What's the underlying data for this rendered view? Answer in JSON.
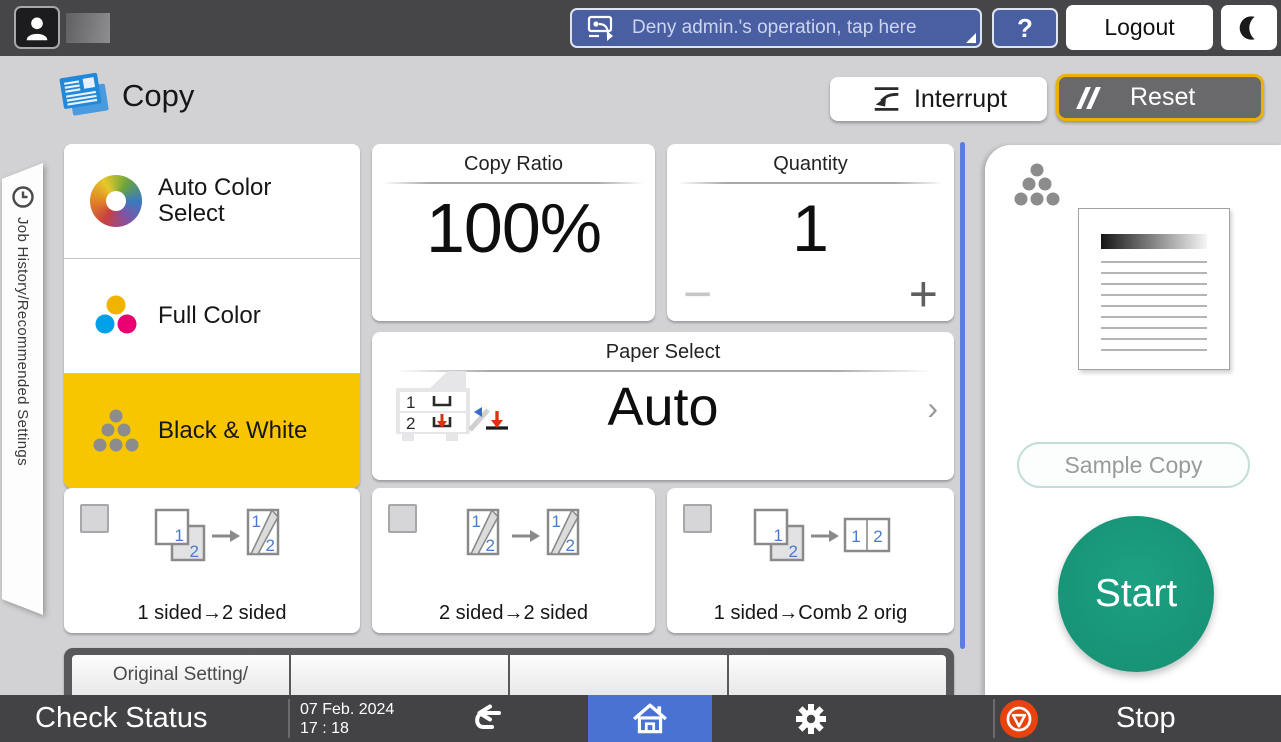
{
  "glyphs": {
    "n1": "1",
    "n2": "2"
  },
  "colors": {
    "selected_yellow": "#f7c600",
    "start_green": "#18977a",
    "stop_red": "#e8430f",
    "home_blue": "#4a72d2",
    "banner_blue": "#4a5ea2",
    "scrollbar_blue": "#5b7ce0"
  },
  "top_bar": {
    "notice_label": "Deny admin.'s operation, tap here",
    "help_label": "?",
    "logout_label": "Logout"
  },
  "header": {
    "title": "Copy",
    "interrupt_label": "Interrupt",
    "reset_label": "Reset"
  },
  "side_tab": {
    "label": "Job History/Recommended Settings"
  },
  "color_modes": [
    {
      "label": "Auto Color Select",
      "selected": false
    },
    {
      "label": "Full Color",
      "selected": false
    },
    {
      "label": "Black & White",
      "selected": true
    }
  ],
  "cards": {
    "copy_ratio": {
      "title": "Copy Ratio",
      "value": "100%"
    },
    "quantity": {
      "title": "Quantity",
      "value": "1",
      "decrement": "−",
      "increment": "+"
    },
    "paper_select": {
      "title": "Paper Select",
      "value": "Auto",
      "chevron": "›"
    }
  },
  "duplex_options": [
    {
      "label": "1 sided→2 sided",
      "checked": false
    },
    {
      "label": "2 sided→2 sided",
      "checked": false
    },
    {
      "label": "1 sided→Comb 2 orig",
      "checked": false
    }
  ],
  "bottom_tabs": {
    "first_label": "Original Setting/"
  },
  "right_panel": {
    "sample_copy_label": "Sample Copy",
    "start_label": "Start"
  },
  "bottom_bar": {
    "check_status_label": "Check Status",
    "date": "07 Feb. 2024",
    "time": "17 : 18",
    "stop_label": "Stop"
  }
}
